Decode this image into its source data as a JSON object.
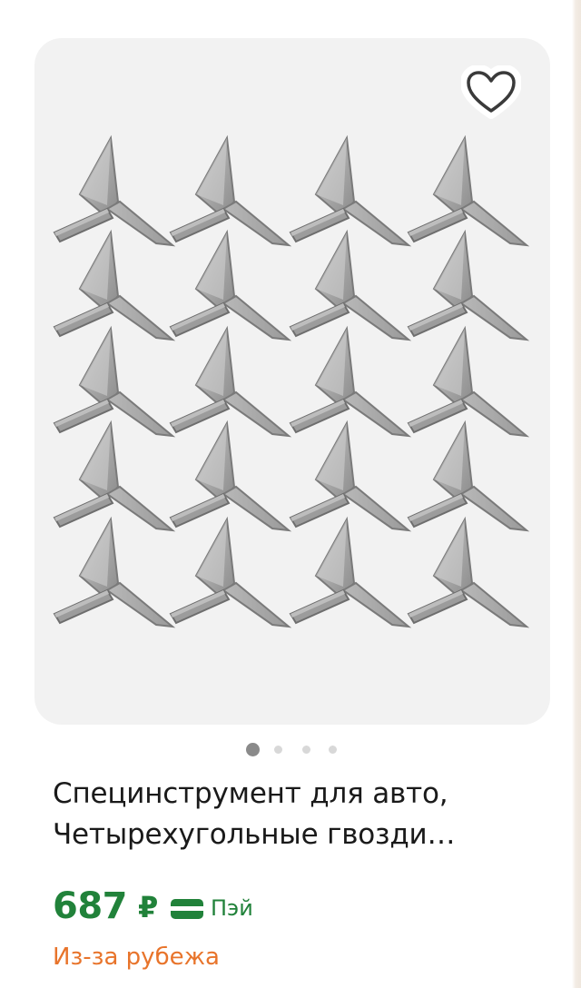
{
  "product": {
    "title_line1": "Специнструмент для авто,",
    "title_line2": "Четырехугольные гвозди…",
    "price": "687",
    "currency": "₽",
    "payment_label": "Пэй",
    "origin": "Из-за рубежа",
    "image_count": 4,
    "active_image": 0
  },
  "icons": {
    "favorite": "heart-icon",
    "payment": "card-icon"
  },
  "colors": {
    "price": "#21823a",
    "origin": "#e8742b",
    "image_background": "#f2f2f2",
    "nail_metal": "#a9a9a9"
  }
}
